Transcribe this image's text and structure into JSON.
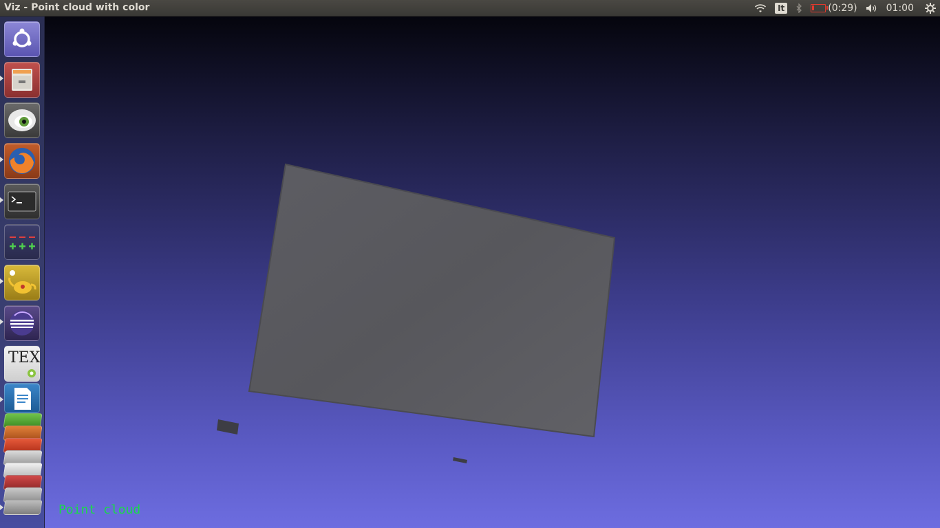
{
  "window": {
    "title": "Viz - Point cloud with color"
  },
  "indicators": {
    "keyboard_layout": "It",
    "battery_time": "(0:29)",
    "clock": "01:00"
  },
  "launcher": {
    "items": [
      {
        "name": "dash-home",
        "icon": "ubuntu-icon"
      },
      {
        "name": "file-manager",
        "icon": "file-cabinet-icon"
      },
      {
        "name": "eye-of-gnome",
        "icon": "eye-icon"
      },
      {
        "name": "firefox",
        "icon": "firefox-icon"
      },
      {
        "name": "terminal",
        "icon": "terminal-icon"
      },
      {
        "name": "calculator",
        "icon": "plus-minus-icon"
      },
      {
        "name": "genie",
        "icon": "teapot-icon"
      },
      {
        "name": "eclipse",
        "icon": "eclipse-icon"
      },
      {
        "name": "tex-editor",
        "icon": "tex-icon"
      },
      {
        "name": "libreoffice-writer",
        "icon": "writer-icon"
      }
    ],
    "tex_label": "TEX"
  },
  "viewport": {
    "caption": "Point cloud",
    "caption_color": "#19d94a",
    "surface_color": "#57575c"
  }
}
